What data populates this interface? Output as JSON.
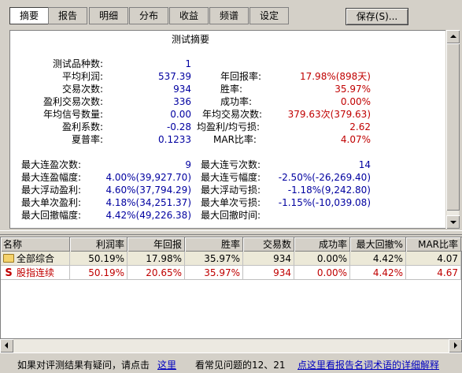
{
  "tabs": [
    {
      "label": "摘要",
      "active": true
    },
    {
      "label": "报告"
    },
    {
      "label": "明细"
    },
    {
      "label": "分布"
    },
    {
      "label": "收益"
    },
    {
      "label": "频谱"
    },
    {
      "label": "设定"
    }
  ],
  "save_button": "保存(S)...",
  "summary": {
    "title": "测试摘要",
    "left": [
      {
        "label": "测试品种数:",
        "value": "1"
      },
      {
        "label": "平均利润:",
        "value": "537.39"
      },
      {
        "label": "交易次数:",
        "value": "934"
      },
      {
        "label": "盈利交易次数:",
        "value": "336"
      },
      {
        "label": "年均信号数量:",
        "value": "0.00"
      },
      {
        "label": "盈利系数:",
        "value": "-0.28"
      },
      {
        "label": "夏普率:",
        "value": "0.1233"
      }
    ],
    "right": [
      {
        "label": "年回报率:",
        "value": "17.98%(898天)"
      },
      {
        "label": "胜率:",
        "value": "35.97%"
      },
      {
        "label": "成功率:",
        "value": "0.00%"
      },
      {
        "label": "年均交易次数:",
        "value": "379.63次(379.63)"
      },
      {
        "label": "均盈利/均亏损:",
        "value": "2.62"
      },
      {
        "label": "MAR比率:",
        "value": "4.07%"
      }
    ],
    "left2": [
      {
        "label": "最大连盈次数:",
        "value": "9"
      },
      {
        "label": "最大连盈幅度:",
        "value": "4.00%(39,927.70)"
      },
      {
        "label": "最大浮动盈利:",
        "value": "4.60%(37,794.29)"
      },
      {
        "label": "最大单次盈利:",
        "value": "4.18%(34,251.37)"
      },
      {
        "label": "最大回撤幅度:",
        "value": "4.42%(49,226.38)"
      }
    ],
    "right2": [
      {
        "label": "最大连亏次数:",
        "value": "14"
      },
      {
        "label": "最大连亏幅度:",
        "value": "-2.50%(-26,269.40)"
      },
      {
        "label": "最大浮动亏损:",
        "value": "-1.18%(9,242.80)"
      },
      {
        "label": "最大单次亏损:",
        "value": "-1.15%(-10,039.08)"
      },
      {
        "label": "最大回撤时间:",
        "value": ""
      }
    ]
  },
  "table": {
    "columns": [
      "名称",
      "利润率",
      "年回报",
      "胜率",
      "交易数",
      "成功率",
      "最大回撤%",
      "MAR比率"
    ],
    "rows": [
      {
        "icon": "folder-icon",
        "name": "全部综合",
        "values": [
          "50.19%",
          "17.98%",
          "35.97%",
          "934",
          "0.00%",
          "4.42%",
          "4.07"
        ],
        "color": "#000000"
      },
      {
        "icon": "s-icon",
        "icon_text": "S",
        "name": "股指连续",
        "values": [
          "50.19%",
          "20.65%",
          "35.97%",
          "934",
          "0.00%",
          "4.42%",
          "4.67"
        ],
        "color": "#c00000"
      }
    ]
  },
  "status": {
    "question_text": "如果对评测结果有疑问，请点击",
    "here_link": "这里",
    "faq_text": "看常见问题的12、21",
    "glossary_link": "点这里看报告名词术语的详细解释"
  }
}
